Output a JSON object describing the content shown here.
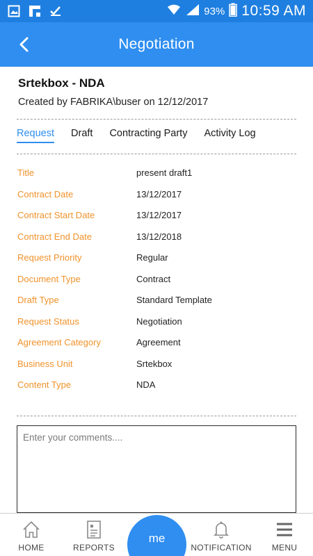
{
  "status_bar": {
    "battery": "93%",
    "time": "10:59 AM"
  },
  "header": {
    "title": "Negotiation"
  },
  "document": {
    "title": "Srtekbox - NDA",
    "created_by": "Created by FABRIKA\\buser on 12/12/2017"
  },
  "tabs": [
    {
      "label": "Request"
    },
    {
      "label": "Draft"
    },
    {
      "label": "Contracting Party"
    },
    {
      "label": "Activity Log"
    }
  ],
  "fields": [
    {
      "label": "Title",
      "value": "present draft1"
    },
    {
      "label": "Contract Date",
      "value": "13/12/2017"
    },
    {
      "label": "Contract Start Date",
      "value": "13/12/2017"
    },
    {
      "label": "Contract End Date",
      "value": "13/12/2018"
    },
    {
      "label": "Request Priority",
      "value": "Regular"
    },
    {
      "label": "Document Type",
      "value": "Contract"
    },
    {
      "label": "Draft Type",
      "value": "Standard Template"
    },
    {
      "label": "Request Status",
      "value": "Negotiation"
    },
    {
      "label": "Agreement Category",
      "value": "Agreement"
    },
    {
      "label": "Business Unit",
      "value": "Srtekbox"
    },
    {
      "label": "Content Type",
      "value": "NDA"
    }
  ],
  "comments": {
    "placeholder": "Enter your comments...."
  },
  "bottom_nav": {
    "home": "HOME",
    "reports": "REPORTS",
    "me": "me",
    "notification": "NOTIFICATION",
    "menu": "MENU"
  },
  "colors": {
    "primary": "#2f8ef0",
    "status_bar": "#1f7fe0",
    "label": "#f0922b"
  },
  "icons": {
    "back": "back-arrow-icon",
    "home": "house-icon",
    "reports": "report-icon",
    "notification": "bell-icon",
    "menu": "hamburger-icon"
  }
}
